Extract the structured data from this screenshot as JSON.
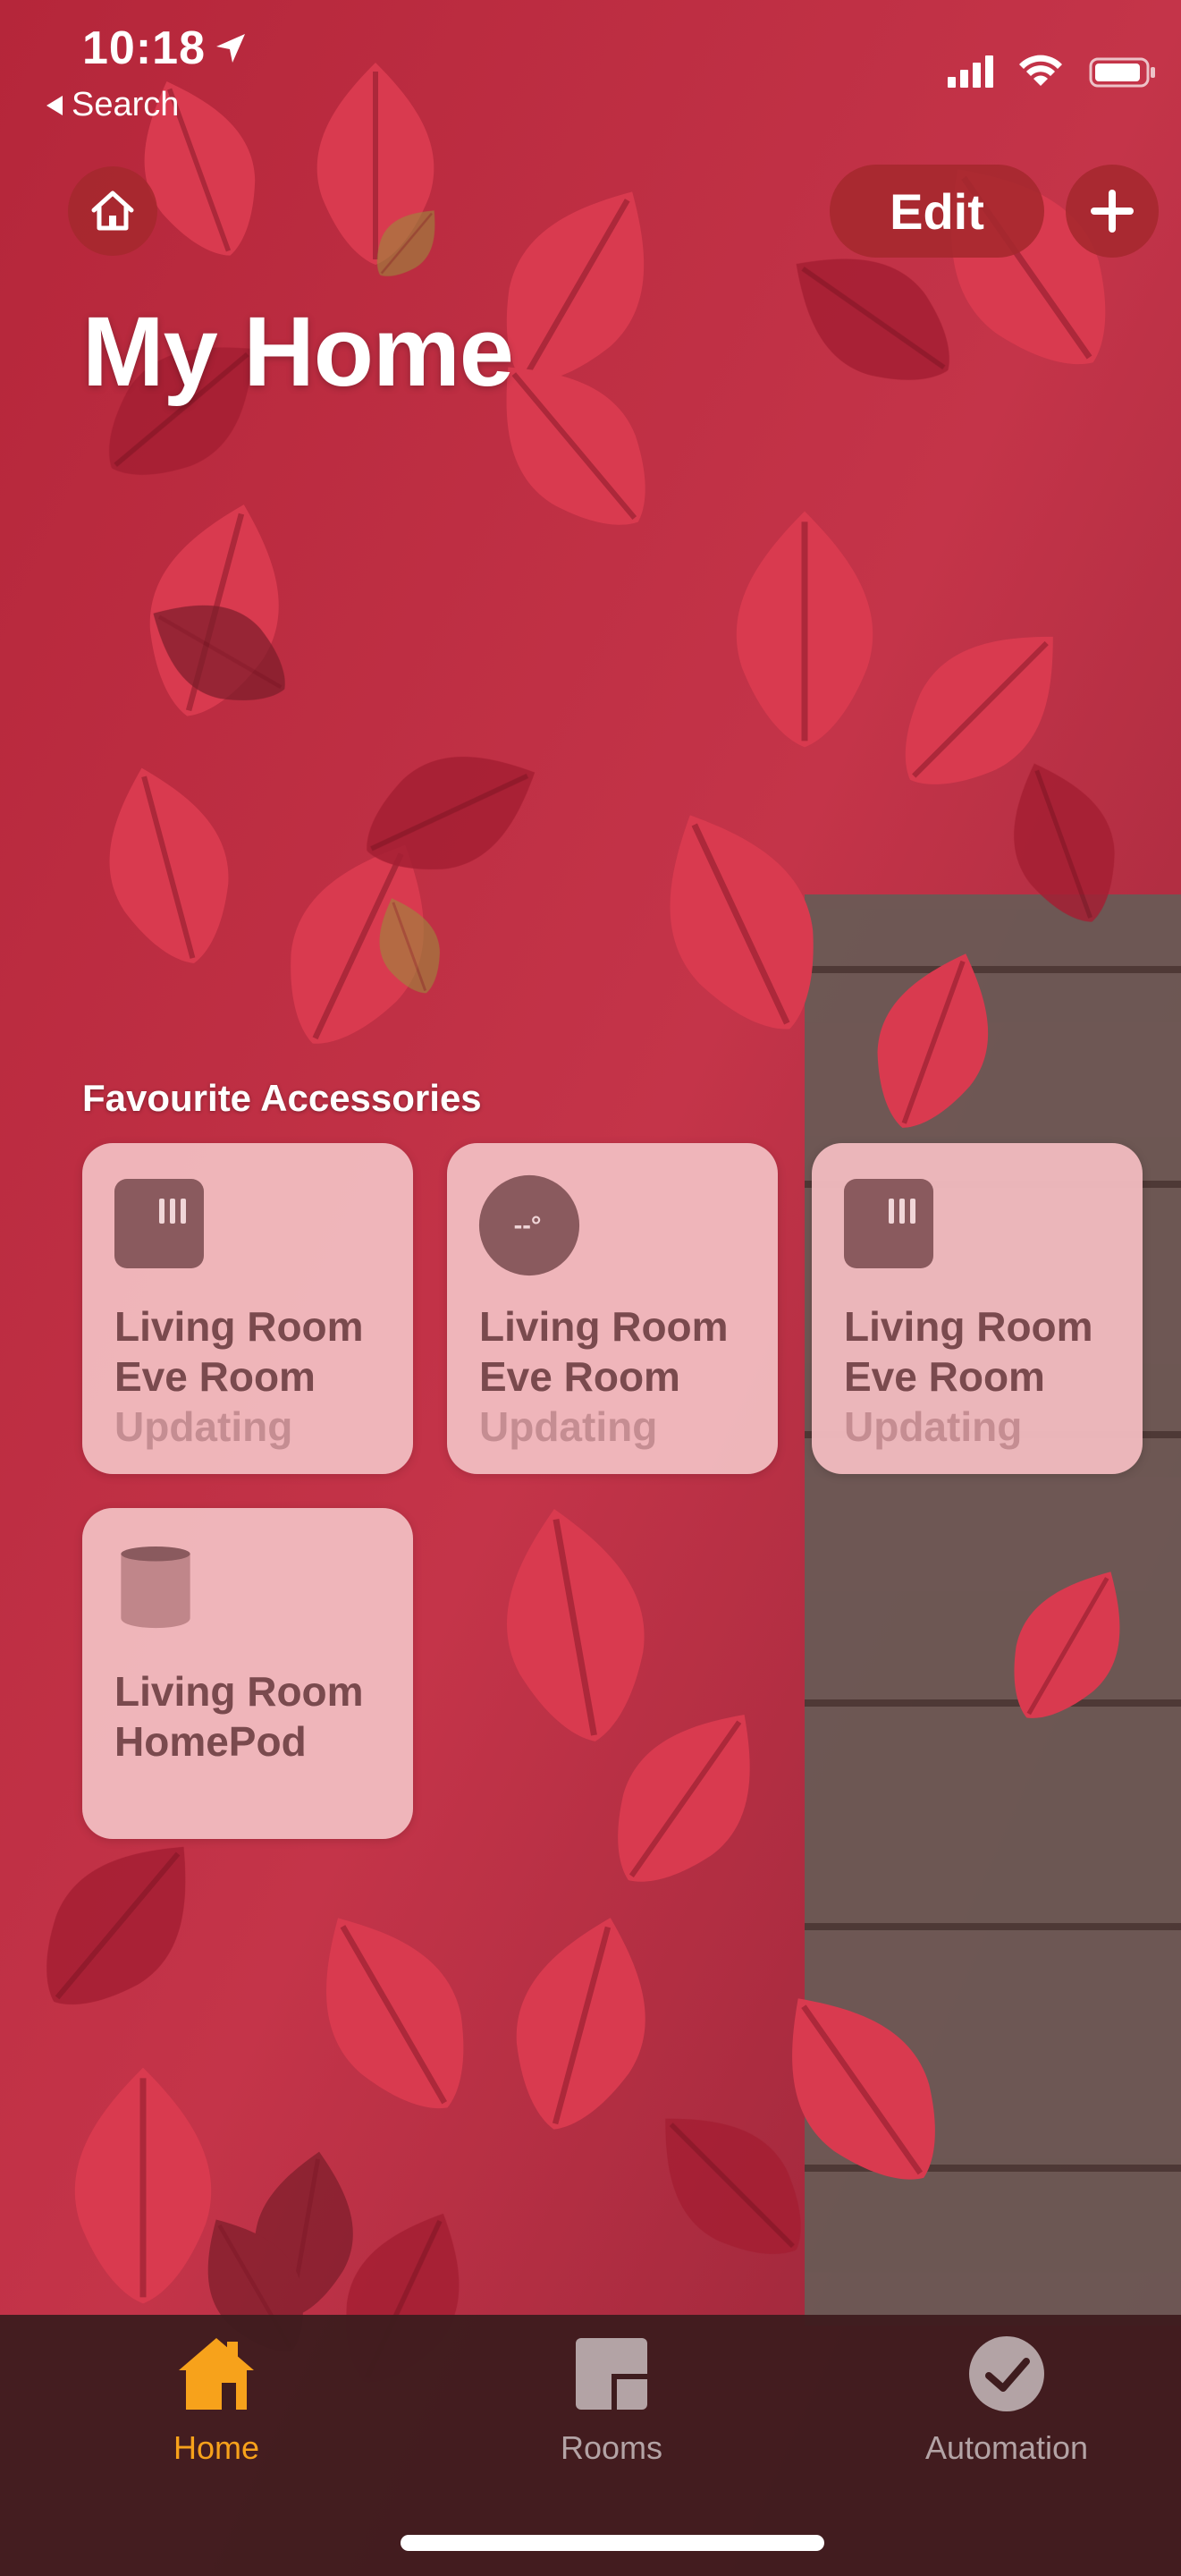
{
  "status": {
    "time": "10:18",
    "back_label": "Search"
  },
  "header": {
    "edit_label": "Edit",
    "title": "My Home"
  },
  "favourites": {
    "title": "Favourite Accessories",
    "tiles": [
      {
        "room": "Living Room",
        "name": "Eve Room",
        "status": "Updating",
        "icon": "sensor-icon"
      },
      {
        "room": "Living Room",
        "name": "Eve Room",
        "status": "Updating",
        "icon": "thermometer-dial-icon",
        "icon_text": "--°"
      },
      {
        "room": "Living Room",
        "name": "Eve Room",
        "status": "Updating",
        "icon": "sensor-icon"
      },
      {
        "room": "Living Room",
        "name": "HomePod",
        "status": "",
        "icon": "homepod-icon"
      }
    ]
  },
  "tabs": [
    {
      "label": "Home",
      "icon": "house-icon",
      "selected": true
    },
    {
      "label": "Rooms",
      "icon": "rooms-icon",
      "selected": false
    },
    {
      "label": "Automation",
      "icon": "clock-check-icon",
      "selected": false
    }
  ],
  "colors": {
    "tile_bg": "#F0BABE",
    "tile_text": "#7A4A4E",
    "tile_status": "#C58D92",
    "accent": "#F7A21B",
    "tab_inactive": "#B3A3A5",
    "button_bg": "#A5282D"
  }
}
